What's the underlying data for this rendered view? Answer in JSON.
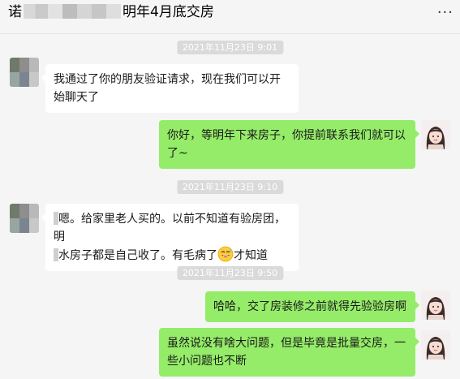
{
  "header": {
    "title_prefix": "诺",
    "title_suffix": "明年4月底交房",
    "more_icon": "more-dots-icon"
  },
  "timestamps": [
    "2021年11月23日 9:01",
    "2021年11月23日 9:10",
    "2021年11月23日 9:50"
  ],
  "messages": [
    {
      "side": "left",
      "text": "我通过了你的朋友验证请求，现在我们可以开始聊天了"
    },
    {
      "side": "right",
      "text": "你好，等明年下来房子，你提前联系我们就可以了~"
    },
    {
      "side": "left",
      "text_a": "嗯。给家里老人买的。以前不知道有验房团，明",
      "text_b": "水房子都是自己收了。有毛病了",
      "text_c": "才知道",
      "emoji": "grinning-sweat-emoji"
    },
    {
      "side": "right",
      "text": "哈哈，交了房装修之前就得先验验房啊"
    },
    {
      "side": "right",
      "text": "虽然说没有啥大问题，但是毕竟是批量交房，一些小问题也不断"
    }
  ],
  "colors": {
    "background": "#f5f5f5",
    "bubble_left": "#ffffff",
    "bubble_right": "#95ec69",
    "timestamp_bg": "#dadada"
  }
}
